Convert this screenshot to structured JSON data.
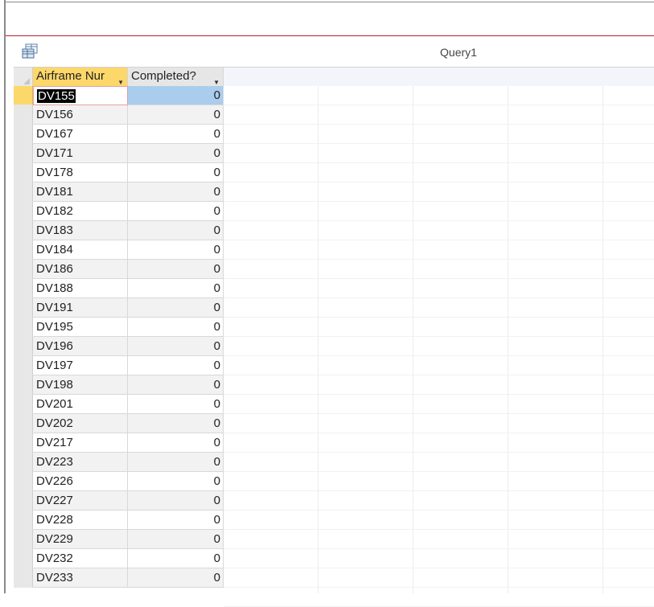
{
  "query": {
    "title": "Query1",
    "icon": "query-datasheet-icon"
  },
  "columns": [
    "Airframe Nur",
    "Completed?"
  ],
  "rows": [
    {
      "airframe": "DV155",
      "completed": "0"
    },
    {
      "airframe": "DV156",
      "completed": "0"
    },
    {
      "airframe": "DV167",
      "completed": "0"
    },
    {
      "airframe": "DV171",
      "completed": "0"
    },
    {
      "airframe": "DV178",
      "completed": "0"
    },
    {
      "airframe": "DV181",
      "completed": "0"
    },
    {
      "airframe": "DV182",
      "completed": "0"
    },
    {
      "airframe": "DV183",
      "completed": "0"
    },
    {
      "airframe": "DV184",
      "completed": "0"
    },
    {
      "airframe": "DV186",
      "completed": "0"
    },
    {
      "airframe": "DV188",
      "completed": "0"
    },
    {
      "airframe": "DV191",
      "completed": "0"
    },
    {
      "airframe": "DV195",
      "completed": "0"
    },
    {
      "airframe": "DV196",
      "completed": "0"
    },
    {
      "airframe": "DV197",
      "completed": "0"
    },
    {
      "airframe": "DV198",
      "completed": "0"
    },
    {
      "airframe": "DV201",
      "completed": "0"
    },
    {
      "airframe": "DV202",
      "completed": "0"
    },
    {
      "airframe": "DV217",
      "completed": "0"
    },
    {
      "airframe": "DV223",
      "completed": "0"
    },
    {
      "airframe": "DV226",
      "completed": "0"
    },
    {
      "airframe": "DV227",
      "completed": "0"
    },
    {
      "airframe": "DV228",
      "completed": "0"
    },
    {
      "airframe": "DV229",
      "completed": "0"
    },
    {
      "airframe": "DV232",
      "completed": "0"
    },
    {
      "airframe": "DV233",
      "completed": "0"
    }
  ]
}
